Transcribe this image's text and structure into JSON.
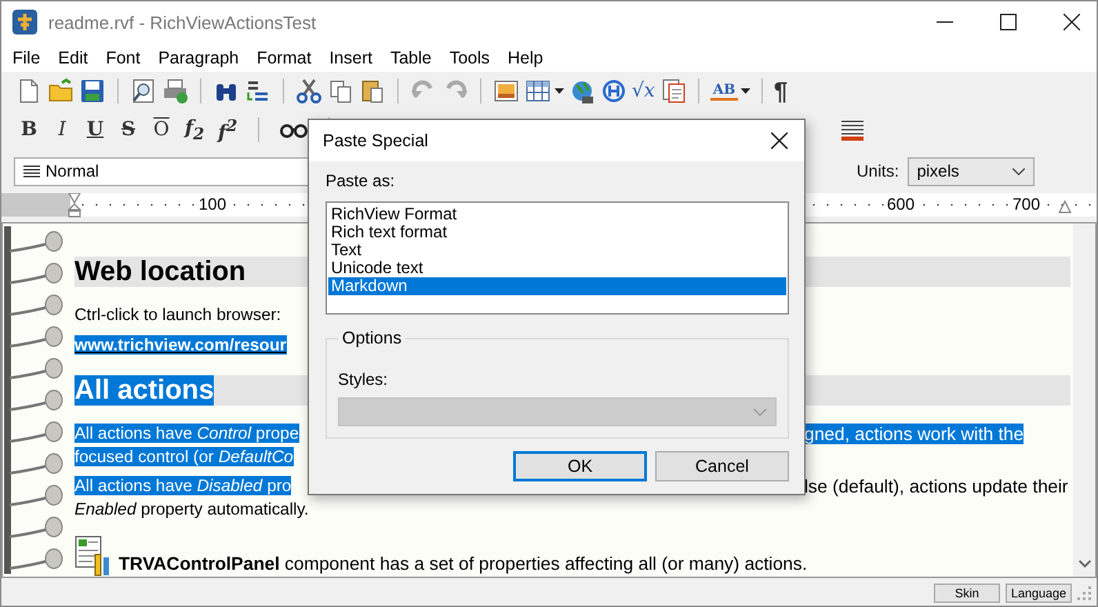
{
  "window": {
    "title": "readme.rvf - RichViewActionsTest"
  },
  "menu": [
    "File",
    "Edit",
    "Font",
    "Paragraph",
    "Format",
    "Insert",
    "Table",
    "Tools",
    "Help"
  ],
  "toolbar": {
    "equation": "√x",
    "spellcheck": "AB",
    "pilcrow": "¶"
  },
  "format_toolbar": [
    {
      "label": "B",
      "kind": "bold"
    },
    {
      "label": "I",
      "kind": "italic"
    },
    {
      "label": "U",
      "kind": "underline"
    },
    {
      "label": "S",
      "kind": "strike"
    },
    {
      "label": "O",
      "kind": "overline"
    },
    {
      "label": "f$_{2}$",
      "kind": "script"
    },
    {
      "label": "f$^{2}$",
      "kind": "script"
    }
  ],
  "style_box": {
    "value": "Normal"
  },
  "units": {
    "label": "Units:",
    "value": "pixels"
  },
  "ruler": {
    "marks": [
      "100",
      "600",
      "700"
    ]
  },
  "document": [
    {
      "kind": "heading",
      "lines": [
        {
          "left": {
            "text": "Web location",
            "selected": false
          }
        }
      ]
    },
    {
      "kind": "text",
      "lines": [
        {
          "left": {
            "text": "Ctrl-click to launch browser:",
            "selected": false
          }
        }
      ]
    },
    {
      "kind": "link",
      "lines": [
        {
          "left": {
            "text": "www.trichview.com/resour",
            "selected": true
          }
        }
      ]
    },
    {
      "kind": "heading",
      "lines": [
        {
          "left": {
            "text": "All actions",
            "selected": true
          }
        }
      ]
    },
    {
      "kind": "text",
      "lines": [
        {
          "left": {
            "text": "All actions have *Control* prope",
            "selected": true
          },
          "right": {
            "text": "gned, actions work with the",
            "selected": true
          }
        },
        {
          "left": {
            "text": "focused control (or *DefaultCo*",
            "selected": true
          }
        }
      ]
    },
    {
      "kind": "text",
      "lines": [
        {
          "left": {
            "text": "All actions have *Disabled* pro",
            "selected": true
          },
          "right": {
            "text": "lse (default), actions update their",
            "selected": false
          }
        },
        {
          "left": {
            "text": "*Enabled* property automatically.",
            "selected": false
          }
        }
      ]
    },
    {
      "kind": "component",
      "lines": [
        {
          "left": {
            "text": "**TRVAControlPanel** component has a set of properties affecting all (or many) actions.",
            "selected": false
          }
        }
      ]
    }
  ],
  "dialog": {
    "title": "Paste Special",
    "paste_as_label": "Paste as:",
    "formats": [
      {
        "label": "RichView Format",
        "selected": false
      },
      {
        "label": "Rich text format",
        "selected": false
      },
      {
        "label": "Text",
        "selected": false
      },
      {
        "label": "Unicode text",
        "selected": false
      },
      {
        "label": "Markdown",
        "selected": true
      }
    ],
    "options_title": "Options",
    "styles_label": "Styles:",
    "styles_disabled": true,
    "buttons": [
      {
        "label": "OK",
        "default": true
      },
      {
        "label": "Cancel",
        "default": false
      }
    ]
  },
  "status_bar": {
    "buttons": [
      "Skin",
      "Language"
    ]
  }
}
